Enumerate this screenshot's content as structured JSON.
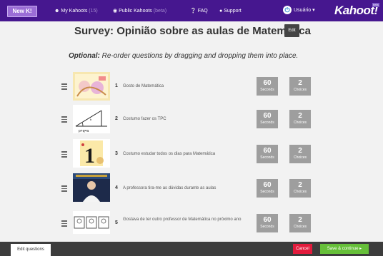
{
  "header": {
    "new_label": "New K!",
    "nav": [
      {
        "icon": "user-icon",
        "label": "My Kahoots",
        "suffix": "(15)"
      },
      {
        "icon": "globe-icon",
        "label": "Public Kahoots",
        "suffix": "(beta)"
      },
      {
        "icon": "help-icon",
        "label": "FAQ",
        "suffix": ""
      },
      {
        "icon": "chat-icon",
        "label": "Support",
        "suffix": ""
      }
    ],
    "username": "Usuário",
    "logo": "Kahoot!",
    "beta": "beta"
  },
  "main": {
    "title": "Survey: Opinião sobre as aulas de Matemática",
    "edit_label": "Edit",
    "instruction_prefix": "Optional:",
    "instruction_text": " Re-order questions by dragging and dropping them into place."
  },
  "questions": [
    {
      "number": "1",
      "text": "Gosto de Matemática",
      "time": "60",
      "time_label": "Seconds",
      "choices": "2",
      "choices_label": "Choices",
      "image": "cartoon-illustration"
    },
    {
      "number": "2",
      "text": "Costumo fazer os TPC",
      "time": "60",
      "time_label": "Seconds",
      "choices": "2",
      "choices_label": "Choices",
      "image": "geometry-diagram"
    },
    {
      "number": "3",
      "text": "Costumo estudar todos os dias para Matemática",
      "time": "60",
      "time_label": "Seconds",
      "choices": "2",
      "choices_label": "Choices",
      "image": "number-one-graphic"
    },
    {
      "number": "4",
      "text": "A professora tira-me as dúvidas durante as aulas",
      "time": "60",
      "time_label": "Seconds",
      "choices": "2",
      "choices_label": "Choices",
      "image": "person-photo"
    },
    {
      "number": "5",
      "text": "Gostava de ter outro professor de Matemática no próximo ano",
      "time": "60",
      "time_label": "Seconds",
      "choices": "2",
      "choices_label": "Choices",
      "image": "sketch-faces"
    }
  ],
  "footer": {
    "edit_questions": "Edit questions",
    "cancel": "Cancel",
    "save": "Save & continue"
  },
  "colors": {
    "header_bg": "#46178f",
    "badge_bg": "#9e9e9e",
    "cancel": "#e21b3c",
    "save": "#66bf39"
  }
}
